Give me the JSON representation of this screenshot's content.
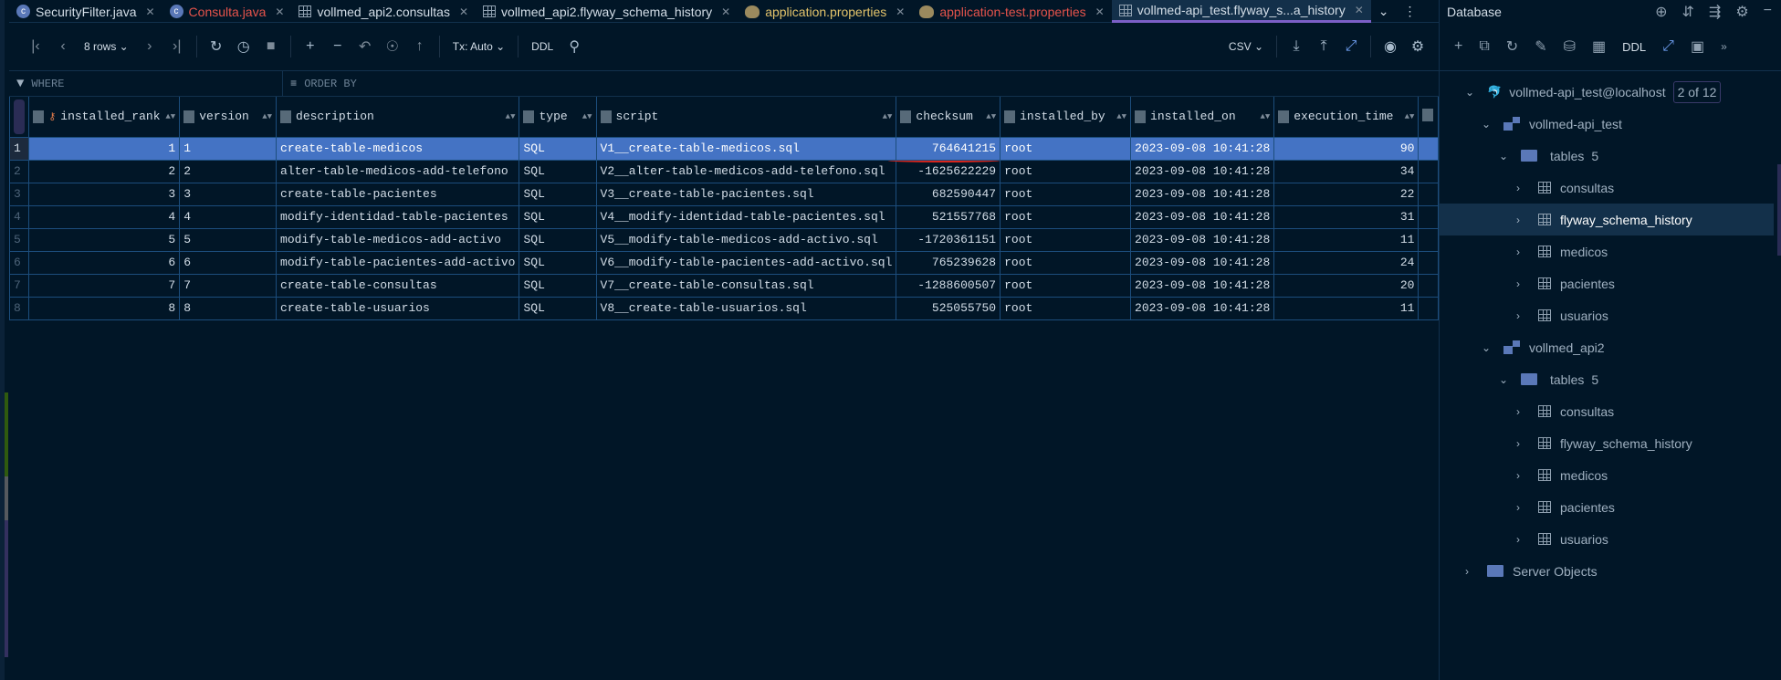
{
  "tabs": [
    {
      "label": "SecurityFilter.java",
      "icon": "class-icon",
      "style": "normal"
    },
    {
      "label": "Consulta.java",
      "icon": "class-icon",
      "style": "red"
    },
    {
      "label": "vollmed_api2.consultas",
      "icon": "table-icon",
      "style": "normal"
    },
    {
      "label": "vollmed_api2.flyway_schema_history",
      "icon": "table-icon",
      "style": "normal"
    },
    {
      "label": "application.properties",
      "icon": "properties-icon",
      "style": "yellow"
    },
    {
      "label": "application-test.properties",
      "icon": "properties-icon",
      "style": "red"
    },
    {
      "label": "vollmed-api_test.flyway_s...a_history",
      "icon": "table-icon",
      "style": "active"
    }
  ],
  "toolbar": {
    "rows": "8 rows",
    "tx": "Tx: Auto",
    "ddl": "DDL",
    "export": "CSV"
  },
  "filter": {
    "where": "WHERE",
    "order_by": "ORDER BY"
  },
  "columns": [
    "installed_rank",
    "version",
    "description",
    "type",
    "script",
    "checksum",
    "installed_by",
    "installed_on",
    "execution_time"
  ],
  "rows": [
    [
      "1",
      "1",
      "1",
      "create-table-medicos",
      "SQL",
      "V1__create-table-medicos.sql",
      "764641215",
      "root",
      "2023-09-08 10:41:28",
      "90"
    ],
    [
      "2",
      "2",
      "2",
      "alter-table-medicos-add-telefono",
      "SQL",
      "V2__alter-table-medicos-add-telefono.sql",
      "-1625622229",
      "root",
      "2023-09-08 10:41:28",
      "34"
    ],
    [
      "3",
      "3",
      "3",
      "create-table-pacientes",
      "SQL",
      "V3__create-table-pacientes.sql",
      "682590447",
      "root",
      "2023-09-08 10:41:28",
      "22"
    ],
    [
      "4",
      "4",
      "4",
      "modify-identidad-table-pacientes",
      "SQL",
      "V4__modify-identidad-table-pacientes.sql",
      "521557768",
      "root",
      "2023-09-08 10:41:28",
      "31"
    ],
    [
      "5",
      "5",
      "5",
      "modify-table-medicos-add-activo",
      "SQL",
      "V5__modify-table-medicos-add-activo.sql",
      "-1720361151",
      "root",
      "2023-09-08 10:41:28",
      "11"
    ],
    [
      "6",
      "6",
      "6",
      "modify-table-pacientes-add-activo",
      "SQL",
      "V6__modify-table-pacientes-add-activo.sql",
      "765239628",
      "root",
      "2023-09-08 10:41:28",
      "24"
    ],
    [
      "7",
      "7",
      "7",
      "create-table-consultas",
      "SQL",
      "V7__create-table-consultas.sql",
      "-1288600507",
      "root",
      "2023-09-08 10:41:28",
      "20"
    ],
    [
      "8",
      "8",
      "8",
      "create-table-usuarios",
      "SQL",
      "V8__create-table-usuarios.sql",
      "525055750",
      "root",
      "2023-09-08 10:41:28",
      "11"
    ]
  ],
  "database": {
    "title": "Database",
    "ddl": "DDL",
    "connection": "vollmed-api_test@localhost",
    "connection_badge": "2 of 12",
    "schemas": [
      {
        "name": "vollmed-api_test",
        "folder": "tables",
        "count": "5",
        "tables": [
          "consultas",
          "flyway_schema_history",
          "medicos",
          "pacientes",
          "usuarios"
        ]
      },
      {
        "name": "vollmed_api2",
        "folder": "tables",
        "count": "5",
        "tables": [
          "consultas",
          "flyway_schema_history",
          "medicos",
          "pacientes",
          "usuarios"
        ]
      }
    ],
    "server_objects": "Server Objects",
    "selected": "flyway_schema_history"
  }
}
